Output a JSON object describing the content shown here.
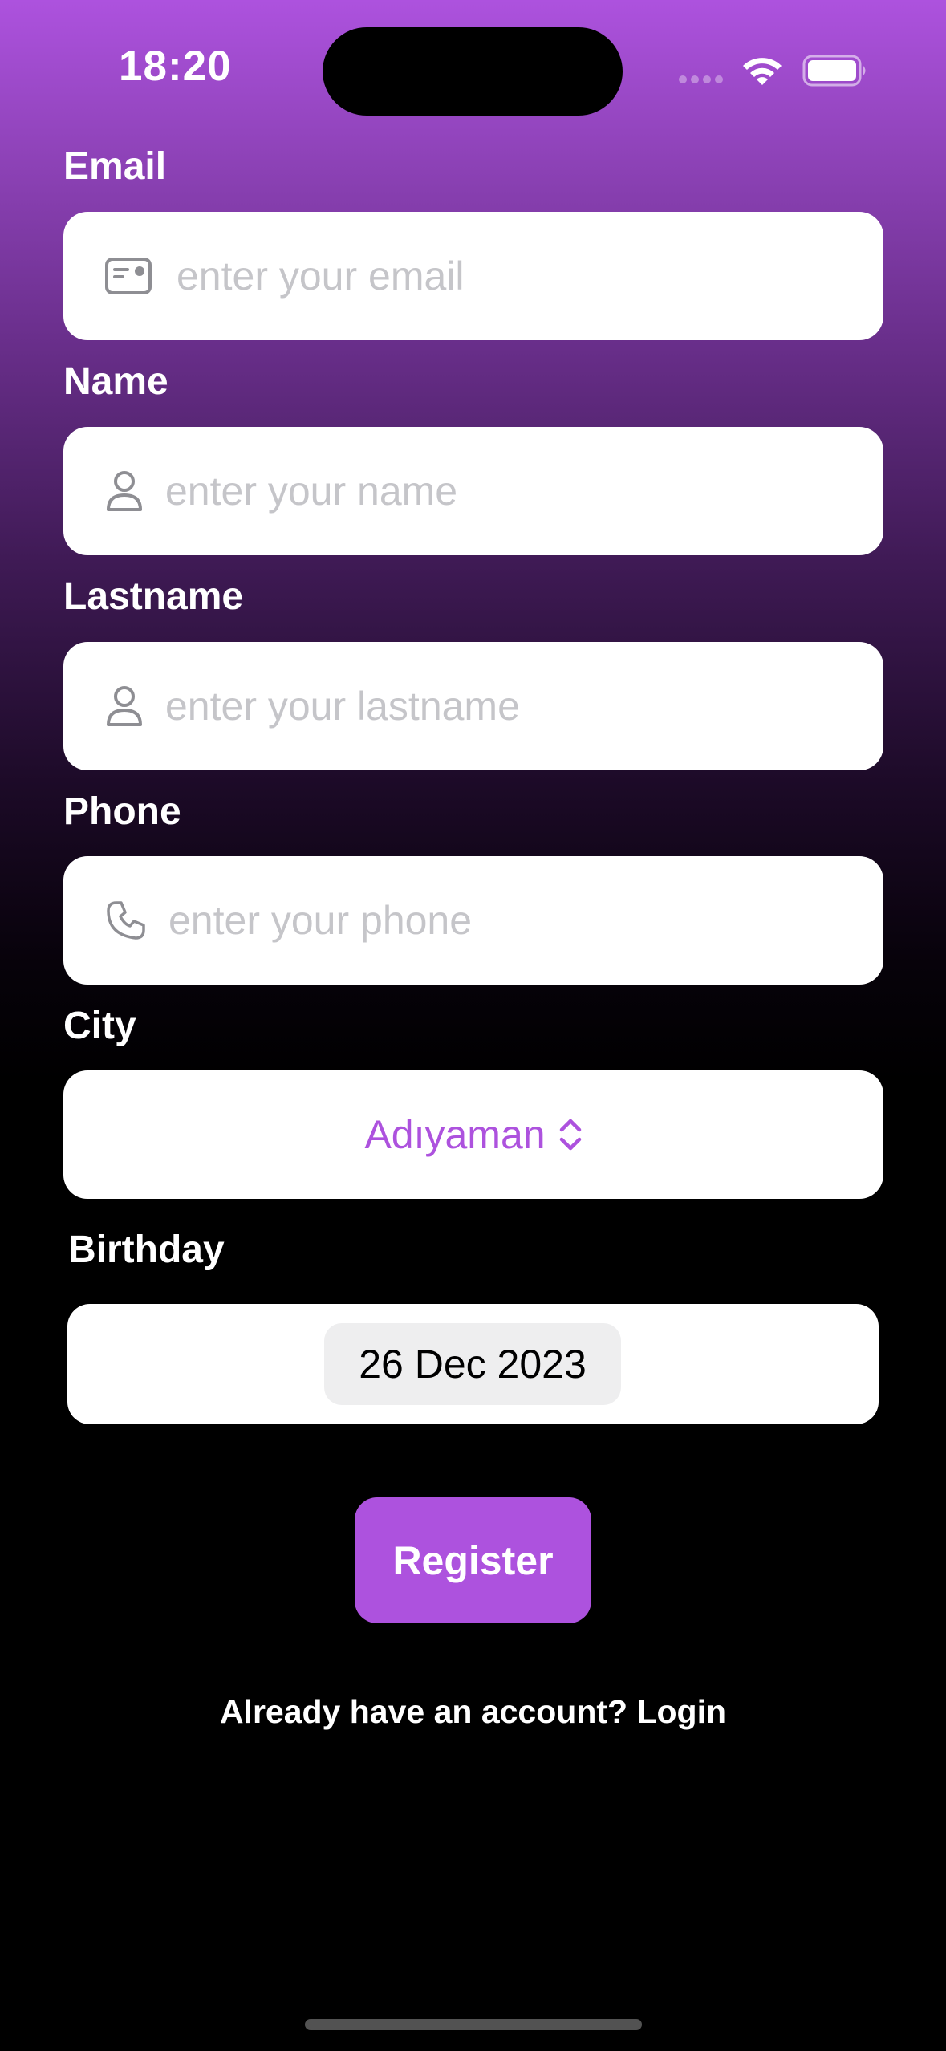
{
  "status_bar": {
    "time": "18:20",
    "signal_icon": "cellular-dots-icon",
    "wifi_icon": "wifi-icon",
    "battery_icon": "battery-full-icon"
  },
  "form": {
    "email": {
      "label": "Email",
      "placeholder": "enter your email",
      "value": "",
      "icon": "id-card-icon"
    },
    "name": {
      "label": "Name",
      "placeholder": "enter your name",
      "value": "",
      "icon": "person-icon"
    },
    "lastname": {
      "label": "Lastname",
      "placeholder": "enter your lastname",
      "value": "",
      "icon": "person-icon"
    },
    "phone": {
      "label": "Phone",
      "placeholder": "enter your phone",
      "value": "",
      "icon": "phone-icon"
    },
    "city": {
      "label": "City",
      "selected": "Adıyaman",
      "icon": "chevron-up-down-icon"
    },
    "birthday": {
      "label": "Birthday",
      "value": "26 Dec 2023"
    }
  },
  "actions": {
    "register_label": "Register",
    "login_prompt": "Already have an account? Login"
  },
  "colors": {
    "accent": "#ad52de",
    "gradient_top": "#ad52de",
    "background_bottom": "#000000",
    "placeholder": "#c5c5c9"
  }
}
